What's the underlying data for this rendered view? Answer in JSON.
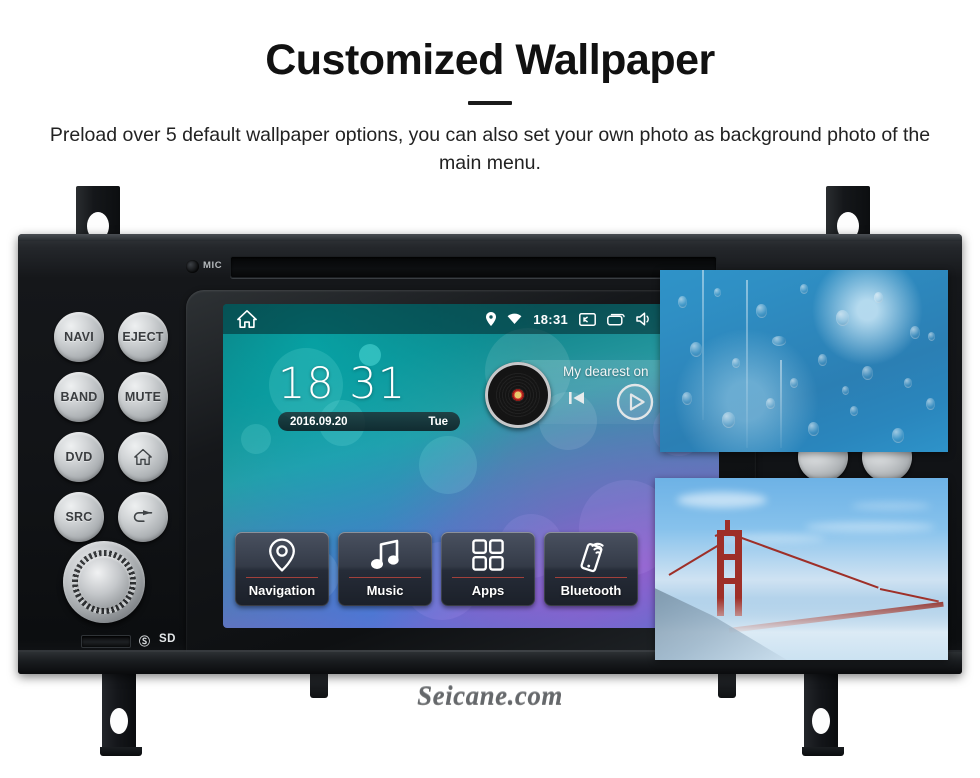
{
  "header": {
    "title": "Customized Wallpaper",
    "subtitle": "Preload over 5 default wallpaper options, you can also set your own photo as background photo of the main menu."
  },
  "device": {
    "mic_label": "MIC",
    "sd_label": "SD",
    "sd_logo": "Ⓢ",
    "watermark": "Seicane.com",
    "buttons": [
      {
        "label": "NAVI",
        "icon": ""
      },
      {
        "label": "EJECT",
        "icon": ""
      },
      {
        "label": "BAND",
        "icon": ""
      },
      {
        "label": "MUTE",
        "icon": ""
      },
      {
        "label": "DVD",
        "icon": ""
      },
      {
        "label": "",
        "icon": "home-icon"
      },
      {
        "label": "SRC",
        "icon": ""
      },
      {
        "label": "",
        "icon": "back-icon"
      }
    ],
    "knob_label": "volume-knob"
  },
  "screen": {
    "statusbar": {
      "home": "home-icon",
      "time": "18:31",
      "icons": [
        "location-pin-icon",
        "wifi-icon",
        "screenshot-icon",
        "recent-apps-icon",
        "volume-icon",
        "eject-icon",
        "screen-off-icon"
      ]
    },
    "clock": {
      "time": "18 31",
      "date": "2016.09.20",
      "day": "Tue"
    },
    "music": {
      "track_title": "My dearest on",
      "prev_label": "previous-track",
      "play_label": "play"
    },
    "tiles": [
      {
        "label": "Navigation",
        "icon": "location-pin-icon"
      },
      {
        "label": "Music",
        "icon": "music-note-icon"
      },
      {
        "label": "Apps",
        "icon": "grid-apps-icon"
      },
      {
        "label": "Bluetooth",
        "icon": "phone-link-icon"
      }
    ]
  },
  "wallpapers": [
    {
      "name": "rain-drops-on-glass"
    },
    {
      "name": "golden-gate-bridge-fog"
    }
  ],
  "colors": {
    "accent_red": "#b8443c",
    "screen_teal": "#10868c",
    "screen_purple": "#8a63c0",
    "chassis": "#111316"
  }
}
